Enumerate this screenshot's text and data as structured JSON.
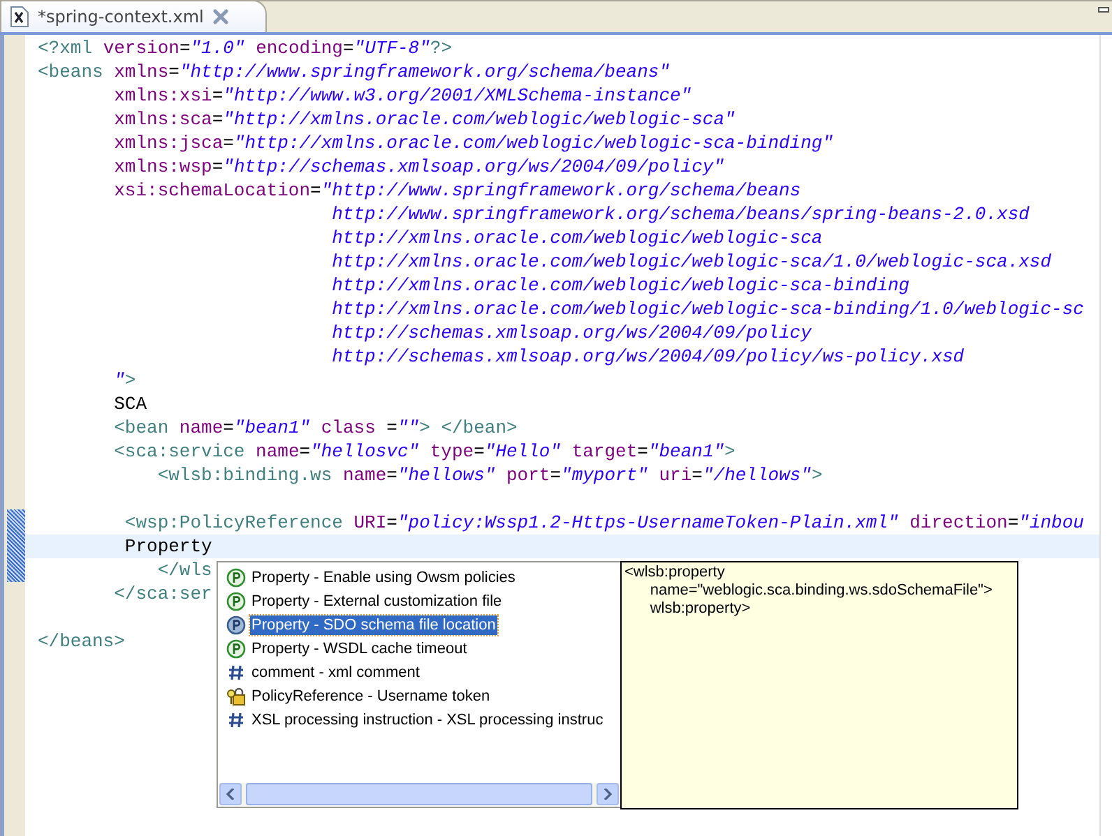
{
  "tab": {
    "title": "*spring-context.xml",
    "dirty": true,
    "selected": true
  },
  "code_lines": [
    {
      "current": false,
      "tokens": [
        {
          "kind": "tag",
          "text": "<?xml"
        },
        {
          "kind": "attr",
          "text": " version"
        },
        {
          "kind": "eq",
          "text": "="
        },
        {
          "kind": "value",
          "text": "\"1.0\""
        },
        {
          "kind": "attr",
          "text": " encoding"
        },
        {
          "kind": "eq",
          "text": "="
        },
        {
          "kind": "value",
          "text": "\"UTF-8\""
        },
        {
          "kind": "tag",
          "text": "?>"
        }
      ]
    },
    {
      "current": false,
      "tokens": [
        {
          "kind": "tag",
          "text": "<beans"
        },
        {
          "kind": "attr",
          "text": " xmlns"
        },
        {
          "kind": "eq",
          "text": "="
        },
        {
          "kind": "value",
          "text": "\"http://www.springframework.org/schema/beans\""
        }
      ]
    },
    {
      "current": false,
      "tokens": [
        {
          "kind": "attr",
          "text": "       xmlns:xsi"
        },
        {
          "kind": "eq",
          "text": "="
        },
        {
          "kind": "value",
          "text": "\"http://www.w3.org/2001/XMLSchema-instance\""
        }
      ]
    },
    {
      "current": false,
      "tokens": [
        {
          "kind": "attr",
          "text": "       xmlns:sca"
        },
        {
          "kind": "eq",
          "text": "="
        },
        {
          "kind": "value",
          "text": "\"http://xmlns.oracle.com/weblogic/weblogic-sca\""
        }
      ]
    },
    {
      "current": false,
      "tokens": [
        {
          "kind": "attr",
          "text": "       xmlns:jsca"
        },
        {
          "kind": "eq",
          "text": "="
        },
        {
          "kind": "value",
          "text": "\"http://xmlns.oracle.com/weblogic/weblogic-sca-binding\""
        }
      ]
    },
    {
      "current": false,
      "tokens": [
        {
          "kind": "attr",
          "text": "       xmlns:wsp"
        },
        {
          "kind": "eq",
          "text": "="
        },
        {
          "kind": "value",
          "text": "\"http://schemas.xmlsoap.org/ws/2004/09/policy\""
        }
      ]
    },
    {
      "current": false,
      "tokens": [
        {
          "kind": "attr",
          "text": "       xsi:schemaLocation"
        },
        {
          "kind": "eq",
          "text": "="
        },
        {
          "kind": "value",
          "text": "\"http://www.springframework.org/schema/beans"
        }
      ]
    },
    {
      "current": false,
      "tokens": [
        {
          "kind": "value",
          "text": "                           http://www.springframework.org/schema/beans/spring-beans-2.0.xsd"
        }
      ]
    },
    {
      "current": false,
      "tokens": [
        {
          "kind": "value",
          "text": "                           http://xmlns.oracle.com/weblogic/weblogic-sca"
        }
      ]
    },
    {
      "current": false,
      "tokens": [
        {
          "kind": "value",
          "text": "                           http://xmlns.oracle.com/weblogic/weblogic-sca/1.0/weblogic-sca.xsd"
        }
      ]
    },
    {
      "current": false,
      "tokens": [
        {
          "kind": "value",
          "text": "                           http://xmlns.oracle.com/weblogic/weblogic-sca-binding"
        }
      ]
    },
    {
      "current": false,
      "tokens": [
        {
          "kind": "value",
          "text": "                           http://xmlns.oracle.com/weblogic/weblogic-sca-binding/1.0/weblogic-sc"
        }
      ]
    },
    {
      "current": false,
      "tokens": [
        {
          "kind": "value",
          "text": "                           http://schemas.xmlsoap.org/ws/2004/09/policy"
        }
      ]
    },
    {
      "current": false,
      "tokens": [
        {
          "kind": "value",
          "text": "                           http://schemas.xmlsoap.org/ws/2004/09/policy/ws-policy.xsd"
        }
      ]
    },
    {
      "current": false,
      "tokens": [
        {
          "kind": "value",
          "text": "       \""
        },
        {
          "kind": "tag",
          "text": ">"
        }
      ]
    },
    {
      "current": false,
      "tokens": [
        {
          "kind": "text",
          "text": "       SCA"
        }
      ]
    },
    {
      "current": false,
      "tokens": [
        {
          "kind": "tag",
          "text": "       <bean"
        },
        {
          "kind": "attr",
          "text": " name"
        },
        {
          "kind": "eq",
          "text": "="
        },
        {
          "kind": "value",
          "text": "\"bean1\""
        },
        {
          "kind": "attr",
          "text": " class"
        },
        {
          "kind": "eq",
          "text": " ="
        },
        {
          "kind": "value",
          "text": "\"\""
        },
        {
          "kind": "tag",
          "text": ">"
        },
        {
          "kind": "tag",
          "text": " </bean>"
        }
      ]
    },
    {
      "current": false,
      "tokens": [
        {
          "kind": "tag",
          "text": "       <sca:service"
        },
        {
          "kind": "attr",
          "text": " name"
        },
        {
          "kind": "eq",
          "text": "="
        },
        {
          "kind": "value",
          "text": "\"hellosvc\""
        },
        {
          "kind": "attr",
          "text": " type"
        },
        {
          "kind": "eq",
          "text": "="
        },
        {
          "kind": "value",
          "text": "\"Hello\""
        },
        {
          "kind": "attr",
          "text": " target"
        },
        {
          "kind": "eq",
          "text": "="
        },
        {
          "kind": "value",
          "text": "\"bean1\""
        },
        {
          "kind": "tag",
          "text": ">"
        }
      ]
    },
    {
      "current": false,
      "tokens": [
        {
          "kind": "tag",
          "text": "           <wlsb:binding.ws"
        },
        {
          "kind": "attr",
          "text": " name"
        },
        {
          "kind": "eq",
          "text": "="
        },
        {
          "kind": "value",
          "text": "\"hellows\""
        },
        {
          "kind": "attr",
          "text": " port"
        },
        {
          "kind": "eq",
          "text": "="
        },
        {
          "kind": "value",
          "text": "\"myport\""
        },
        {
          "kind": "attr",
          "text": " uri"
        },
        {
          "kind": "eq",
          "text": "="
        },
        {
          "kind": "value",
          "text": "\"/hellows\""
        },
        {
          "kind": "tag",
          "text": ">"
        }
      ]
    },
    {
      "current": false
    },
    {
      "current": false,
      "tokens": [
        {
          "kind": "tag",
          "text": "        <wsp:PolicyReference"
        },
        {
          "kind": "attr",
          "text": " URI"
        },
        {
          "kind": "eq",
          "text": "="
        },
        {
          "kind": "value",
          "text": "\"policy:Wssp1.2-Https-UsernameToken-Plain.xml\""
        },
        {
          "kind": "attr",
          "text": " direction"
        },
        {
          "kind": "eq",
          "text": "="
        },
        {
          "kind": "value",
          "text": "\"inbou"
        }
      ]
    },
    {
      "current": true,
      "tokens": [
        {
          "kind": "text",
          "text": "        Property"
        }
      ]
    },
    {
      "current": false,
      "tokens": [
        {
          "kind": "tag",
          "text": "           </wls"
        }
      ]
    },
    {
      "current": false,
      "tokens": [
        {
          "kind": "tag",
          "text": "       </sca:ser"
        }
      ]
    },
    {
      "current": false
    },
    {
      "current": false,
      "tokens": [
        {
          "kind": "tag",
          "text": "</beans>"
        }
      ]
    }
  ],
  "completion": {
    "items": [
      {
        "kind": "property",
        "label": "Property - Enable using Owsm policies",
        "selected": false
      },
      {
        "kind": "property",
        "label": "Property - External customization file",
        "selected": false
      },
      {
        "kind": "property",
        "label": "Property - SDO schema file location",
        "selected": true
      },
      {
        "kind": "property",
        "label": "Property - WSDL cache timeout",
        "selected": false
      },
      {
        "kind": "template",
        "label": "comment - xml comment",
        "selected": false
      },
      {
        "kind": "policy",
        "label": "PolicyReference - Username token",
        "selected": false
      },
      {
        "kind": "template",
        "label": "XSL processing instruction - XSL processing instruc",
        "selected": false
      }
    ]
  },
  "info_popup": {
    "lines": [
      "<wlsb:property",
      "      name=\"weblogic.sca.binding.ws.sdoSchemaFile\">",
      "      wlsb:property>"
    ]
  }
}
